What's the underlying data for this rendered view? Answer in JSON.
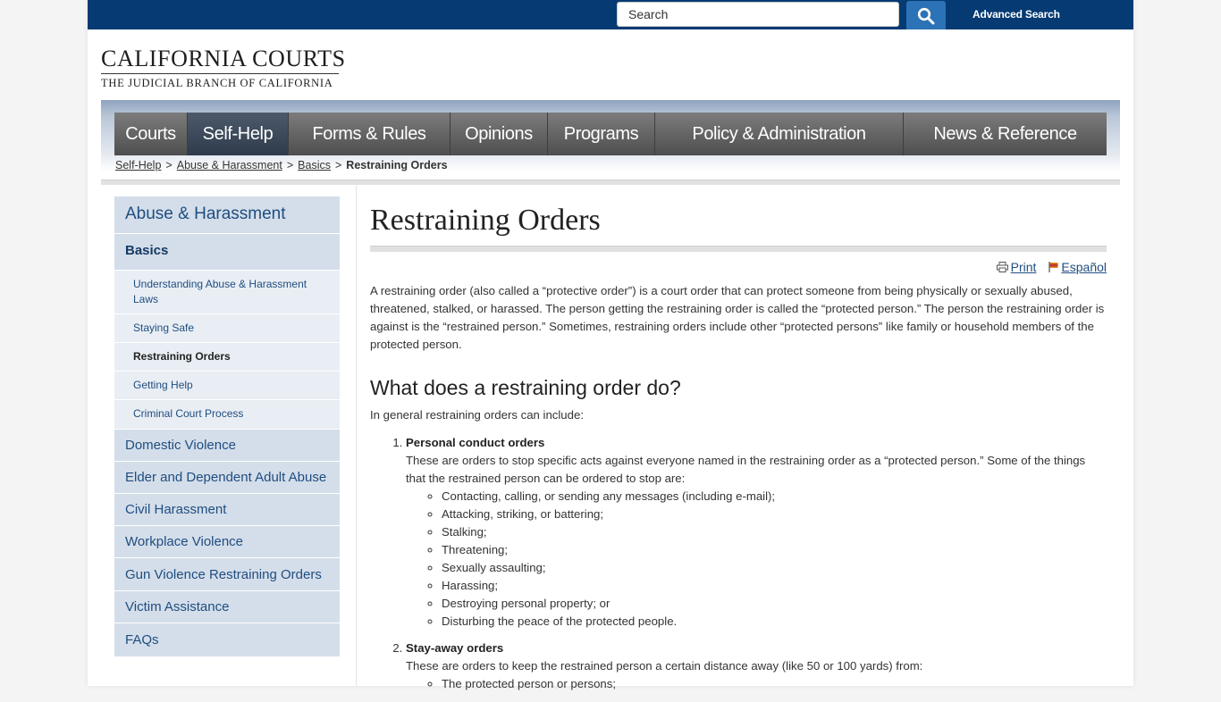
{
  "header": {
    "search_placeholder": "Search",
    "advanced_search": "Advanced Search",
    "logo_main": "CALIFORNIA COURTS",
    "logo_sub": "THE JUDICIAL BRANCH OF CALIFORNIA"
  },
  "nav": [
    {
      "label": "Courts",
      "active": false
    },
    {
      "label": "Self-Help",
      "active": true
    },
    {
      "label": "Forms & Rules",
      "active": false
    },
    {
      "label": "Opinions",
      "active": false
    },
    {
      "label": "Programs",
      "active": false
    },
    {
      "label": "Policy & Administration",
      "active": false
    },
    {
      "label": "News & Reference",
      "active": false
    }
  ],
  "breadcrumb": {
    "items": [
      "Self-Help",
      "Abuse & Harassment",
      "Basics"
    ],
    "current": "Restraining Orders",
    "separator": ">"
  },
  "sidebar": {
    "top": "Abuse & Harassment",
    "basics": "Basics",
    "sub": [
      "Understanding Abuse & Harassment Laws",
      "Staying Safe",
      "Restraining Orders",
      "Getting Help",
      "Criminal Court Process"
    ],
    "current_sub": "Restraining Orders",
    "sections": [
      "Domestic Violence",
      "Elder and Dependent Adult Abuse",
      "Civil Harassment",
      "Workplace Violence",
      "Gun Violence Restraining Orders",
      "Victim Assistance",
      "FAQs"
    ]
  },
  "content": {
    "title": "Restraining Orders",
    "print": "Print",
    "espanol": "Español",
    "intro": "A restraining order (also called a “protective order”) is a court order that can protect someone from being physically or sexually abused, threatened, stalked, or harassed. The person getting the restraining order is called the “protected person.” The person the restraining order is against is the “restrained person.” Sometimes, restraining orders include other “protected persons” like family or household members of the protected person.",
    "heading": "What does a restraining order do?",
    "lead": "In general restraining orders can include:",
    "orders": [
      {
        "title": "Personal conduct orders",
        "desc": "These are orders to stop specific acts against everyone named in the restraining order as a “protected person.” Some of the things that the restrained person can be ordered to stop are:",
        "items": [
          "Contacting, calling, or sending any messages (including e-mail);",
          "Attacking, striking, or battering;",
          "Stalking;",
          "Threatening;",
          "Sexually assaulting;",
          "Harassing;",
          "Destroying personal property; or",
          "Disturbing the peace of the protected people."
        ]
      },
      {
        "title": "Stay-away orders",
        "desc": "These are orders to keep the restrained person a certain distance away (like 50 or 100 yards) from:",
        "items": [
          "The protected person or persons;"
        ]
      }
    ]
  },
  "colors": {
    "topbar": "#053a73",
    "search_button": "#2b73b6",
    "nav_active": "#2f3b4b",
    "sidebar_bg": "#d4deea",
    "link": "#1f4d80"
  }
}
